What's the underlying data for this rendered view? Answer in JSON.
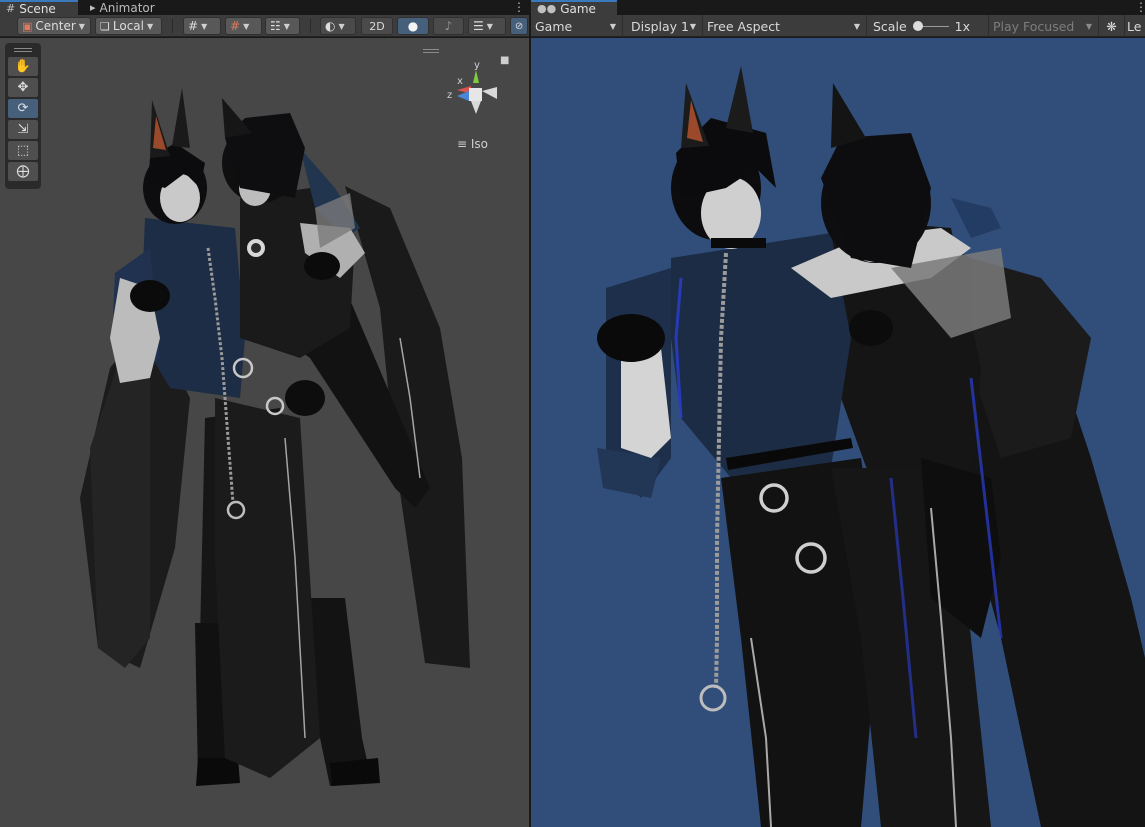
{
  "tabs": {
    "scene": "Scene",
    "animator": "Animator",
    "game": "Game"
  },
  "scene_toolbar": {
    "pivot_mode": "Center",
    "pivot_rotation": "Local",
    "mode_2d": "2D"
  },
  "game_toolbar": {
    "view_type": "Game",
    "display": "Display 1",
    "aspect": "Free Aspect",
    "scale_label": "Scale",
    "scale_value": "1x",
    "play_mode": "Play Focused",
    "trailing_label": "Le"
  },
  "scene_view": {
    "projection": "Iso",
    "gizmo_axes": {
      "x": "x",
      "y": "y",
      "z": "z"
    },
    "tools": [
      "hand-icon",
      "move-icon",
      "rotate-icon",
      "scale-icon",
      "rect-icon",
      "transform-icon"
    ],
    "active_tool": 2
  },
  "colors": {
    "scene_bg": "#474747",
    "game_bg": "#314d79",
    "accent": "#3a79bb",
    "toolbar_bg": "#3c3c3c"
  }
}
